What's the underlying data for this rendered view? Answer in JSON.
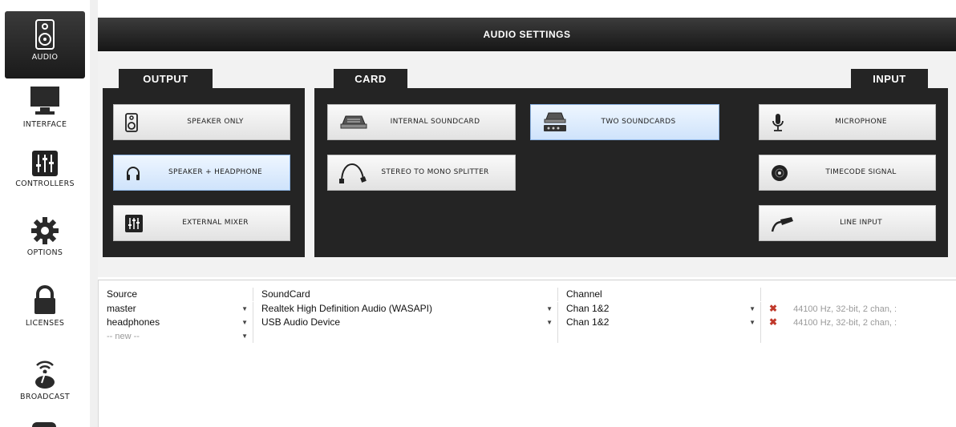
{
  "sidebar": {
    "items": [
      {
        "label": "AUDIO",
        "icon": "speaker-icon"
      },
      {
        "label": "INTERFACE",
        "icon": "monitor-icon"
      },
      {
        "label": "CONTROLLERS",
        "icon": "mixer-sliders-icon"
      },
      {
        "label": "OPTIONS",
        "icon": "gear-icon"
      },
      {
        "label": "LICENSES",
        "icon": "lock-icon"
      },
      {
        "label": "BROADCAST",
        "icon": "broadcast-icon"
      }
    ]
  },
  "header": {
    "title": "AUDIO SETTINGS"
  },
  "output": {
    "tab": "OUTPUT",
    "buttons": [
      {
        "label": "SPEAKER ONLY",
        "icon": "speaker-icon"
      },
      {
        "label": "SPEAKER + HEADPHONE",
        "icon": "headphones-icon"
      },
      {
        "label": "EXTERNAL MIXER",
        "icon": "mixer-sliders-icon"
      }
    ]
  },
  "card": {
    "tab": "CARD",
    "buttons": [
      {
        "label": "INTERNAL SOUNDCARD",
        "icon": "soundcard-icon"
      },
      {
        "label": "TWO SOUNDCARDS",
        "icon": "two-soundcards-icon"
      },
      {
        "label": "STEREO TO MONO SPLITTER",
        "icon": "splitter-cable-icon"
      }
    ]
  },
  "input": {
    "tab": "INPUT",
    "buttons": [
      {
        "label": "MICROPHONE",
        "icon": "microphone-icon"
      },
      {
        "label": "TIMECODE SIGNAL",
        "icon": "vinyl-icon"
      },
      {
        "label": "LINE INPUT",
        "icon": "cable-icon"
      }
    ]
  },
  "table": {
    "headers": [
      "Source",
      "SoundCard",
      "Channel",
      ""
    ],
    "rows": [
      {
        "source": "master",
        "soundcard": "Realtek High Definition Audio (WASAPI)",
        "channel": "Chan 1&2",
        "info": "44100 Hz, 32-bit, 2 chan, :"
      },
      {
        "source": "headphones",
        "soundcard": "USB Audio Device",
        "channel": "Chan 1&2",
        "info": "44100 Hz, 32-bit, 2 chan, :"
      },
      {
        "source": "-- new --",
        "soundcard": "",
        "channel": "",
        "info": ""
      }
    ]
  },
  "colors": {
    "panel": "#242424",
    "selected": "#cfe3fb",
    "remove": "#c0392b"
  }
}
